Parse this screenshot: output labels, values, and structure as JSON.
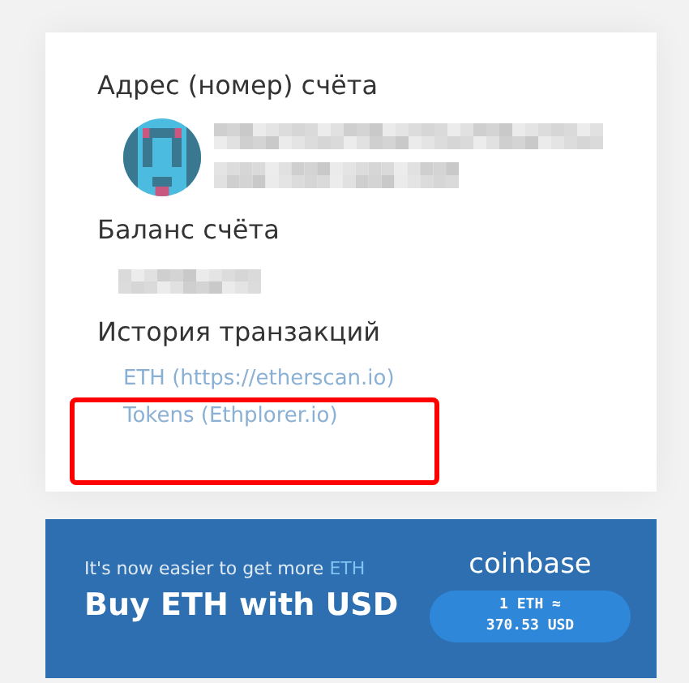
{
  "account": {
    "address_heading": "Адрес (номер) счёта",
    "balance_heading": "Баланс счёта",
    "history_heading": "История транзакций",
    "history_links": [
      {
        "label": "ETH (https://etherscan.io)"
      },
      {
        "label": "Tokens (Ethplorer.io)"
      }
    ]
  },
  "banner": {
    "tagline": "It's now easier to get more",
    "tagline_highlight": "ETH",
    "headline": "Buy ETH with USD",
    "brand": "coinbase",
    "rate_line_1": "1 ETH ≈",
    "rate_line_2": "370.53 USD"
  }
}
